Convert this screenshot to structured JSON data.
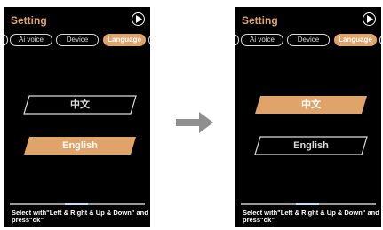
{
  "colors": {
    "accent": "#e0a46a",
    "screen_bg": "#000000",
    "tab_border": "#dcdcdc",
    "arrow": "#8f8f8f"
  },
  "icons": {
    "play": "play-circle-icon",
    "arrow": "arrow-right-icon"
  },
  "screens": [
    {
      "title": "Setting",
      "tabs": [
        "Ai voice",
        "Device",
        "Language"
      ],
      "selected_tab": "Language",
      "options": [
        {
          "label": "中文",
          "selected": false
        },
        {
          "label": "English",
          "selected": true
        }
      ],
      "hint": "Select with\"Left & Right & Up & Down\" and press\"ok\""
    },
    {
      "title": "Setting",
      "tabs": [
        "Ai voice",
        "Device",
        "Language"
      ],
      "selected_tab": "Language",
      "options": [
        {
          "label": "中文",
          "selected": true
        },
        {
          "label": "English",
          "selected": false
        }
      ],
      "hint": "Select with\"Left & Right & Up & Down\" and press\"ok\""
    }
  ]
}
